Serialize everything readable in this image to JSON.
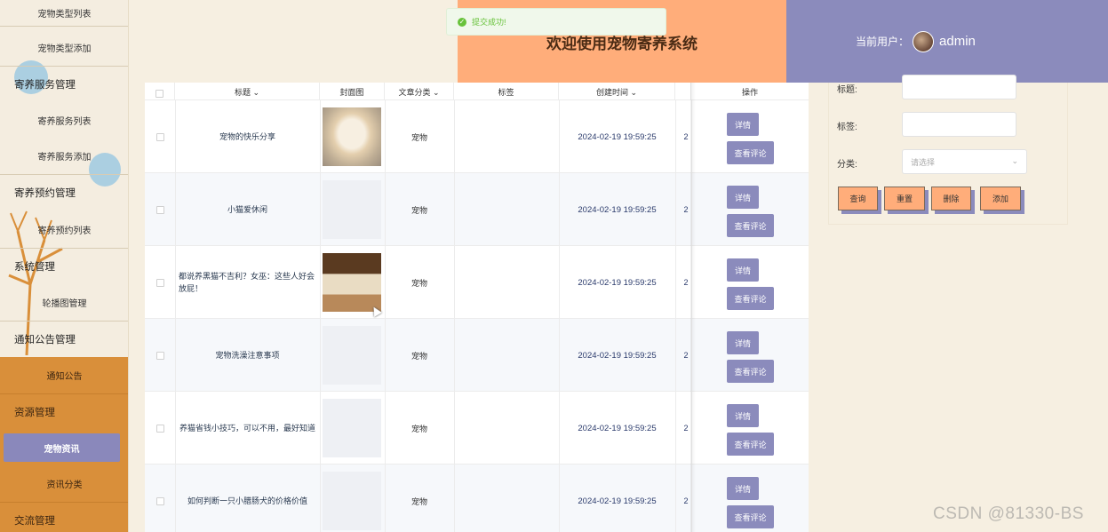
{
  "sidebar": {
    "items": [
      {
        "label": "宠物类型列表"
      },
      {
        "label": "宠物类型添加"
      },
      {
        "label": "寄养服务管理"
      },
      {
        "label": "寄养服务列表"
      },
      {
        "label": "寄养服务添加"
      },
      {
        "label": "寄养预约管理"
      },
      {
        "label": "寄养预约列表"
      },
      {
        "label": "系统管理"
      },
      {
        "label": "轮播图管理"
      },
      {
        "label": "通知公告管理"
      },
      {
        "label": "通知公告"
      },
      {
        "label": "资源管理"
      },
      {
        "label": "宠物资讯"
      },
      {
        "label": "资讯分类"
      },
      {
        "label": "交流管理"
      }
    ],
    "active": "宠物资讯"
  },
  "header": {
    "title": "欢迎使用宠物寄养系统",
    "user_label": "当前用户：",
    "username": "admin"
  },
  "toast": {
    "message": "提交成功!"
  },
  "table": {
    "columns": [
      "标题",
      "封面图",
      "文章分类",
      "标签",
      "创建时间",
      "操作"
    ],
    "rows": [
      {
        "title": "宠物的快乐分享",
        "image": "dog",
        "category": "宠物",
        "tag": "",
        "created": "2024-02-19 19:59:25",
        "extra": "2"
      },
      {
        "title": "小猫爱休闲",
        "image": "",
        "category": "宠物",
        "tag": "",
        "created": "2024-02-19 19:59:25",
        "extra": "2"
      },
      {
        "title": "都说养黑猫不吉利？女巫：这些人好会放屁！",
        "image": "cat",
        "category": "宠物",
        "tag": "",
        "created": "2024-02-19 19:59:25",
        "extra": "2"
      },
      {
        "title": "宠物洗澡注意事项",
        "image": "",
        "category": "宠物",
        "tag": "",
        "created": "2024-02-19 19:59:25",
        "extra": "2"
      },
      {
        "title": "养猫省钱小技巧，可以不用，最好知道",
        "image": "",
        "category": "宠物",
        "tag": "",
        "created": "2024-02-19 19:59:25",
        "extra": "2"
      },
      {
        "title": "如何判断一只小腊肠犬的价格价值",
        "image": "",
        "category": "宠物",
        "tag": "",
        "created": "2024-02-19 19:59:25",
        "extra": "2"
      }
    ],
    "detail_label": "详情",
    "comment_label": "查看评论"
  },
  "search": {
    "title_label": "标题:",
    "tag_label": "标签:",
    "category_label": "分类:",
    "category_placeholder": "请选择",
    "query_label": "查询",
    "reset_label": "重置",
    "delete_label": "删除",
    "add_label": "添加"
  },
  "watermark": "CSDN @81330-BS"
}
